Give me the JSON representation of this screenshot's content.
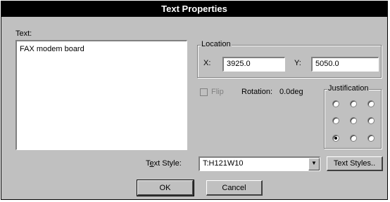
{
  "dialog": {
    "title": "Text Properties",
    "text_label": "Text:",
    "text_value": "FAX modem board",
    "location": {
      "label": "Location",
      "x_label": "X:",
      "x_value": "3925.0",
      "y_label": "Y:",
      "y_value": "5050.0"
    },
    "flip_label": "Flip",
    "flip_checked": false,
    "rotation_label": "Rotation:",
    "rotation_value": "0.0deg",
    "justification": {
      "label": "Justification",
      "selected_row": 2,
      "selected_col": 0
    },
    "text_style_label": "Text Style:",
    "text_style_value": "T:H121W10",
    "text_styles_button": "Text Styles..",
    "ok_button": "OK",
    "cancel_button": "Cancel"
  }
}
